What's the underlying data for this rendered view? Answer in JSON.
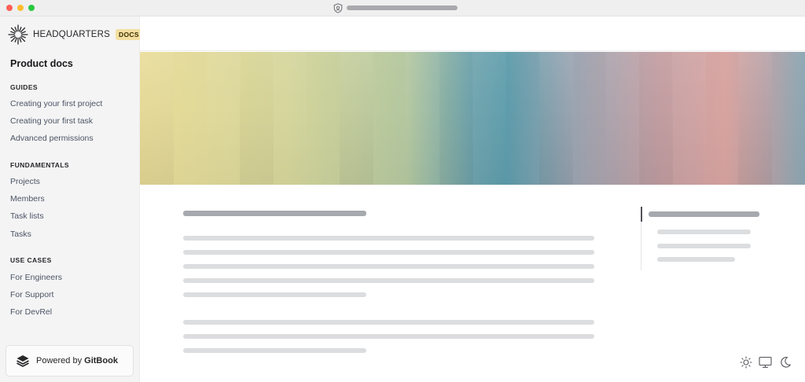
{
  "brand": {
    "name": "HEADQUARTERS",
    "badge": "DOCS"
  },
  "space_title": "Product docs",
  "sidebar": {
    "sections": [
      {
        "heading": "GUIDES",
        "items": [
          "Creating your first project",
          "Creating your first task",
          "Advanced permissions"
        ]
      },
      {
        "heading": "FUNDAMENTALS",
        "items": [
          "Projects",
          "Members",
          "Task lists",
          "Tasks"
        ]
      },
      {
        "heading": "USE CASES",
        "items": [
          "For Engineers",
          "For Support",
          "For DevRel"
        ]
      }
    ]
  },
  "footer": {
    "powered_prefix": "Powered by ",
    "powered_brand": "GitBook"
  },
  "icons": {
    "window": [
      "close",
      "minimize",
      "maximize"
    ],
    "address_bar": "shield-icon",
    "theme_toggle": [
      "sun-icon",
      "monitor-icon",
      "moon-icon"
    ]
  },
  "colors": {
    "badge_bg": "#f3dfa1",
    "sidebar_bg": "#f4f4f5",
    "skeleton_dark": "#a6a9ae",
    "skeleton_light": "#dcdddf"
  }
}
